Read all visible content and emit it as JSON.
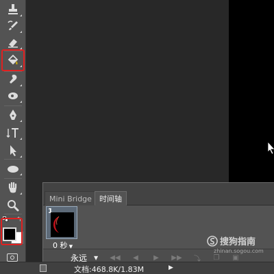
{
  "panel": {
    "tabs": [
      {
        "label": "Mini Bridge",
        "active": false
      },
      {
        "label": "时间轴",
        "active": true
      }
    ],
    "frame": {
      "number": "1",
      "delay": "0 秒"
    },
    "loop": "永远"
  },
  "statusbar": {
    "text": "文档:468.8K/1.83M"
  },
  "watermark": {
    "text": "搜狗指南",
    "sub": "zhinan.sogou.com"
  },
  "tools": [
    "stamp-tool",
    "history-brush-tool",
    "eraser-tool",
    "paint-bucket-tool",
    "blur-tool",
    "dodge-tool",
    "pen-tool",
    "type-tool",
    "path-selection-tool",
    "ellipse-tool",
    "hand-tool",
    "zoom-tool"
  ],
  "colors": {
    "highlight": "#e02020",
    "foreground": "#000000",
    "background": "#ffffff",
    "canvas": "#000000"
  }
}
